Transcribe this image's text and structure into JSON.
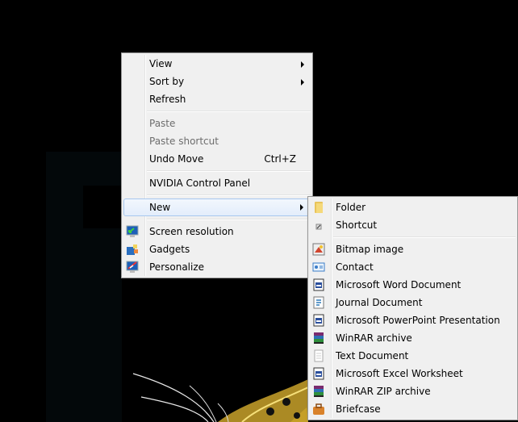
{
  "main_menu": {
    "items": [
      {
        "label": "View",
        "submenu": true,
        "enabled": true
      },
      {
        "label": "Sort by",
        "submenu": true,
        "enabled": true
      },
      {
        "label": "Refresh",
        "enabled": true
      },
      {
        "label": "Paste",
        "enabled": false
      },
      {
        "label": "Paste shortcut",
        "enabled": false
      },
      {
        "label": "Undo Move",
        "shortcut": "Ctrl+Z",
        "enabled": true
      },
      {
        "label": "NVIDIA Control Panel",
        "enabled": true
      },
      {
        "label": "New",
        "submenu": true,
        "enabled": true,
        "highlighted": true
      },
      {
        "label": "Screen resolution",
        "icon": "screen-resolution-icon",
        "enabled": true
      },
      {
        "label": "Gadgets",
        "icon": "gadgets-icon",
        "enabled": true
      },
      {
        "label": "Personalize",
        "icon": "personalize-icon",
        "enabled": true
      }
    ]
  },
  "new_submenu": {
    "items": [
      {
        "label": "Folder",
        "icon": "folder-icon"
      },
      {
        "label": "Shortcut",
        "icon": "shortcut-icon"
      },
      {
        "label": "Bitmap image",
        "icon": "bitmap-icon"
      },
      {
        "label": "Contact",
        "icon": "contact-icon"
      },
      {
        "label": "Microsoft Word Document",
        "icon": "word-document-icon"
      },
      {
        "label": "Journal Document",
        "icon": "journal-document-icon"
      },
      {
        "label": "Microsoft PowerPoint Presentation",
        "icon": "powerpoint-icon"
      },
      {
        "label": "WinRAR archive",
        "icon": "winrar-icon"
      },
      {
        "label": "Text Document",
        "icon": "text-document-icon"
      },
      {
        "label": "Microsoft Excel Worksheet",
        "icon": "excel-icon"
      },
      {
        "label": "WinRAR ZIP archive",
        "icon": "winrar-zip-icon"
      },
      {
        "label": "Briefcase",
        "icon": "briefcase-icon"
      }
    ]
  },
  "colors": {
    "menu_bg": "#f0f0f0",
    "highlight_border": "#a8c8ef",
    "disabled_text": "#6d6d6d"
  }
}
